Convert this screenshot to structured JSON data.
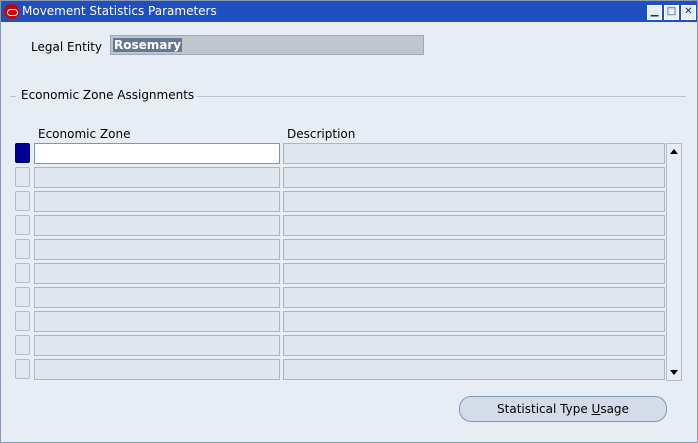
{
  "window": {
    "title": "Movement Statistics Parameters",
    "min_glyph": "▁",
    "max_glyph": "□",
    "close_glyph": "✕"
  },
  "legal": {
    "label": "Legal Entity",
    "value": "Rosemary"
  },
  "section": {
    "title": "Economic Zone Assignments"
  },
  "table": {
    "headers": {
      "zone": "Economic Zone",
      "description": "Description"
    },
    "rows": [
      {
        "zone": "",
        "description": ""
      },
      {
        "zone": "",
        "description": ""
      },
      {
        "zone": "",
        "description": ""
      },
      {
        "zone": "",
        "description": ""
      },
      {
        "zone": "",
        "description": ""
      },
      {
        "zone": "",
        "description": ""
      },
      {
        "zone": "",
        "description": ""
      },
      {
        "zone": "",
        "description": ""
      },
      {
        "zone": "",
        "description": ""
      },
      {
        "zone": "",
        "description": ""
      }
    ]
  },
  "button": {
    "label_before": "Statistical Type ",
    "label_underlined": "U",
    "label_after": "sage"
  },
  "colors": {
    "titlebar": "#2050c0",
    "panel": "#e6edf5",
    "current_row_indicator": "#000099",
    "legal_highlight": "#66788f"
  },
  "icons": {
    "app": "oracle-logo-icon",
    "minimize": "minimize-icon",
    "maximize": "maximize-icon",
    "close": "close-icon",
    "scroll_up": "arrow-up-icon",
    "scroll_down": "arrow-down-icon"
  }
}
